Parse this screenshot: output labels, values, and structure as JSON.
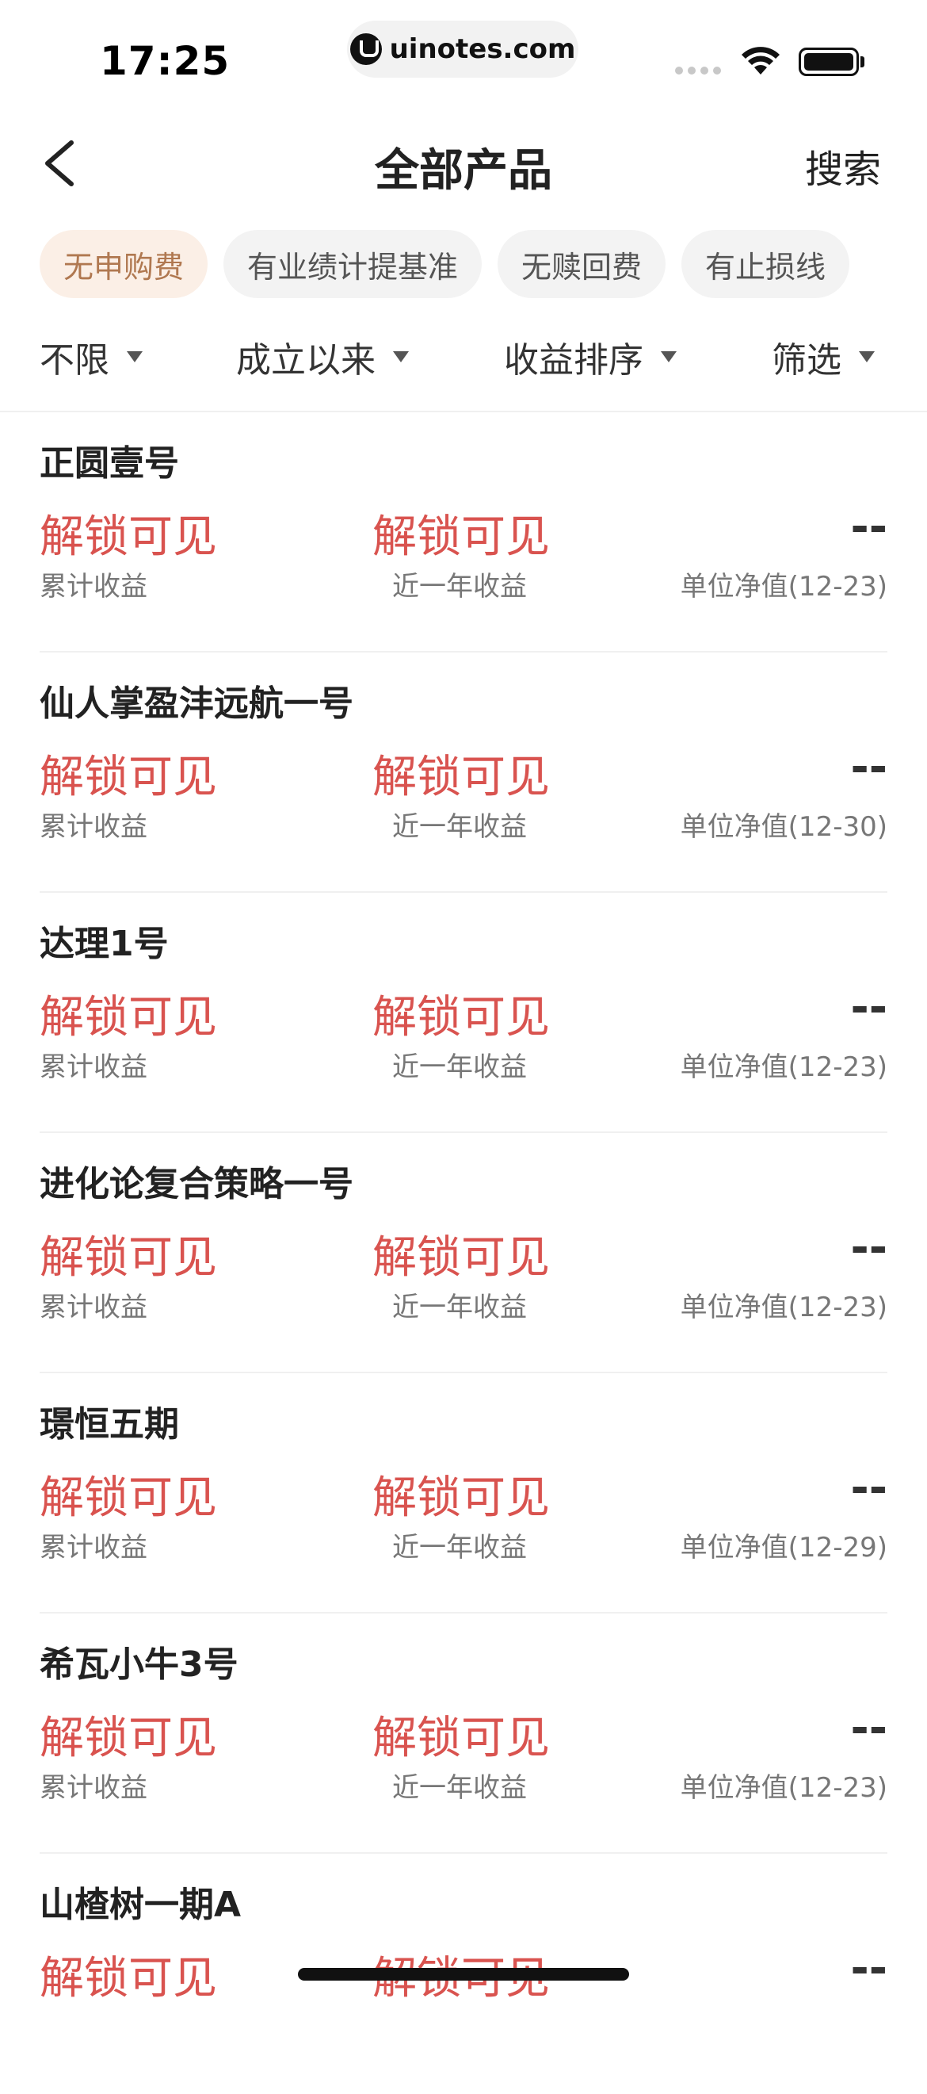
{
  "status_bar": {
    "time": "17:25",
    "url": "uinotes.com"
  },
  "nav": {
    "title": "全部产品",
    "search_label": "搜索"
  },
  "tags": [
    {
      "label": "无申购费",
      "active": true
    },
    {
      "label": "有业绩计提基准",
      "active": false
    },
    {
      "label": "无赎回费",
      "active": false
    },
    {
      "label": "有止损线",
      "active": false
    }
  ],
  "filters": [
    {
      "label": "不限"
    },
    {
      "label": "成立以来"
    },
    {
      "label": "收益排序"
    },
    {
      "label": "筛选"
    }
  ],
  "colors": {
    "accent_red": "#d9534f",
    "active_tag_bg": "#fbefe6",
    "active_tag_text": "#b07850"
  },
  "products": [
    {
      "name": "正圆壹号",
      "cumulative_value": "解锁可见",
      "cumulative_label": "累计收益",
      "year_value": "解锁可见",
      "year_label": "近一年收益",
      "nav_value": "--",
      "nav_label": "单位净值(12-23)"
    },
    {
      "name": "仙人掌盈沣远航一号",
      "cumulative_value": "解锁可见",
      "cumulative_label": "累计收益",
      "year_value": "解锁可见",
      "year_label": "近一年收益",
      "nav_value": "--",
      "nav_label": "单位净值(12-30)"
    },
    {
      "name": "达理1号",
      "cumulative_value": "解锁可见",
      "cumulative_label": "累计收益",
      "year_value": "解锁可见",
      "year_label": "近一年收益",
      "nav_value": "--",
      "nav_label": "单位净值(12-23)"
    },
    {
      "name": "进化论复合策略一号",
      "cumulative_value": "解锁可见",
      "cumulative_label": "累计收益",
      "year_value": "解锁可见",
      "year_label": "近一年收益",
      "nav_value": "--",
      "nav_label": "单位净值(12-23)"
    },
    {
      "name": "璟恒五期",
      "cumulative_value": "解锁可见",
      "cumulative_label": "累计收益",
      "year_value": "解锁可见",
      "year_label": "近一年收益",
      "nav_value": "--",
      "nav_label": "单位净值(12-29)"
    },
    {
      "name": "希瓦小牛3号",
      "cumulative_value": "解锁可见",
      "cumulative_label": "累计收益",
      "year_value": "解锁可见",
      "year_label": "近一年收益",
      "nav_value": "--",
      "nav_label": "单位净值(12-23)"
    },
    {
      "name": "山楂树一期A",
      "cumulative_value": "解锁可见",
      "cumulative_label": "",
      "year_value": "解锁可见",
      "year_label": "",
      "nav_value": "--",
      "nav_label": ""
    }
  ]
}
